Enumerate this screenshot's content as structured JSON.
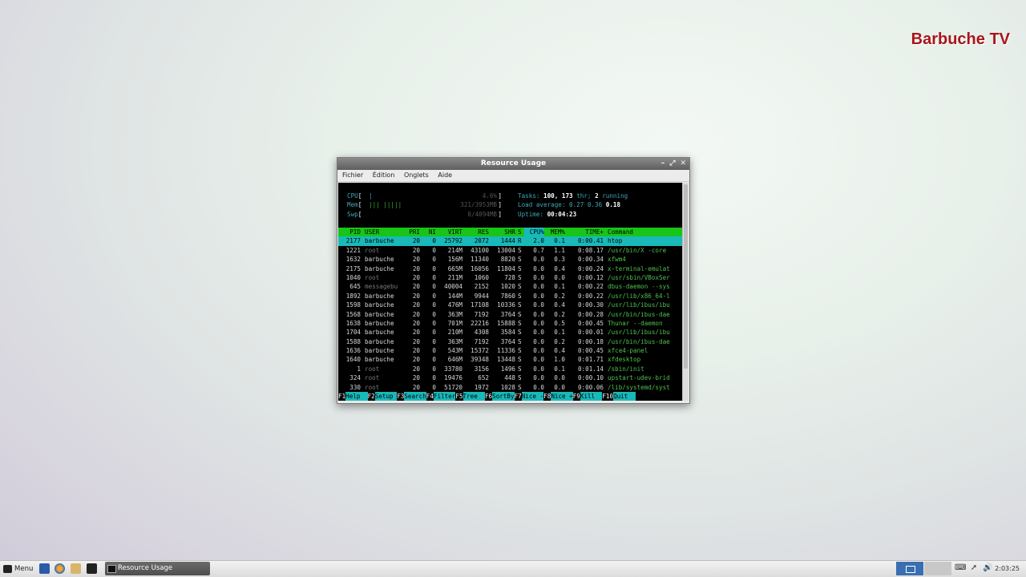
{
  "watermark": "Barbuche TV",
  "window": {
    "title": "Resource Usage",
    "menu": [
      "Fichier",
      "Édition",
      "Onglets",
      "Aide"
    ]
  },
  "meters": [
    {
      "label": "CPU",
      "bar": "|",
      "value": "4.6%"
    },
    {
      "label": "Mem",
      "bar": "||| |||||",
      "value": "321/3953MB"
    },
    {
      "label": "Swp",
      "bar": "",
      "value": "0/4094MB"
    }
  ],
  "stats": {
    "tasks_label": "Tasks:",
    "tasks": "100,",
    "threads": "173",
    "threads_label": "thr;",
    "running": "2",
    "running_label": "running",
    "load_label": "Load average:",
    "load1": "0.27",
    "load5": "0.36",
    "load15": "0.18",
    "uptime_label": "Uptime:",
    "uptime": "00:04:23"
  },
  "table": {
    "headers": [
      "PID",
      "USER",
      "PRI",
      "NI",
      "VIRT",
      "RES",
      "SHR",
      "S",
      "CPU%",
      "MEM%",
      "TIME+",
      "Command"
    ],
    "rows": [
      [
        "2177",
        "barbuche",
        "20",
        "0",
        "25792",
        "2072",
        "1444",
        "R",
        "2.0",
        "0.1",
        "0:00.41",
        "htop"
      ],
      [
        "1221",
        "root",
        "20",
        "0",
        "214M",
        "43100",
        "13004",
        "S",
        "0.7",
        "1.1",
        "0:08.17",
        "/usr/bin/X -core"
      ],
      [
        "1632",
        "barbuche",
        "20",
        "0",
        "156M",
        "11340",
        "8820",
        "S",
        "0.0",
        "0.3",
        "0:00.34",
        "xfwm4"
      ],
      [
        "2175",
        "barbuche",
        "20",
        "0",
        "665M",
        "16056",
        "11804",
        "S",
        "0.0",
        "0.4",
        "0:00.24",
        "x-terminal-emulat"
      ],
      [
        "1040",
        "root",
        "20",
        "0",
        "211M",
        "1060",
        "728",
        "S",
        "0.0",
        "0.0",
        "0:00.12",
        "/usr/sbin/VBoxSer"
      ],
      [
        "645",
        "messagebu",
        "20",
        "0",
        "40004",
        "2152",
        "1020",
        "S",
        "0.0",
        "0.1",
        "0:00.22",
        "dbus-daemon --sys"
      ],
      [
        "1892",
        "barbuche",
        "20",
        "0",
        "144M",
        "9944",
        "7860",
        "S",
        "0.0",
        "0.2",
        "0:00.22",
        "/usr/lib/x86_64-l"
      ],
      [
        "1598",
        "barbuche",
        "20",
        "0",
        "476M",
        "17108",
        "10336",
        "S",
        "0.0",
        "0.4",
        "0:00.30",
        "/usr/lib/ibus/ibu"
      ],
      [
        "1568",
        "barbuche",
        "20",
        "0",
        "363M",
        "7192",
        "3764",
        "S",
        "0.0",
        "0.2",
        "0:00.28",
        "/usr/bin/ibus-dae"
      ],
      [
        "1638",
        "barbuche",
        "20",
        "0",
        "701M",
        "22216",
        "15888",
        "S",
        "0.0",
        "0.5",
        "0:00.45",
        "Thunar --daemon"
      ],
      [
        "1704",
        "barbuche",
        "20",
        "0",
        "210M",
        "4308",
        "3584",
        "S",
        "0.0",
        "0.1",
        "0:00.01",
        "/usr/lib/ibus/ibu"
      ],
      [
        "1588",
        "barbuche",
        "20",
        "0",
        "363M",
        "7192",
        "3764",
        "S",
        "0.0",
        "0.2",
        "0:00.18",
        "/usr/bin/ibus-dae"
      ],
      [
        "1636",
        "barbuche",
        "20",
        "0",
        "543M",
        "15372",
        "11336",
        "S",
        "0.0",
        "0.4",
        "0:00.45",
        "xfce4-panel"
      ],
      [
        "1640",
        "barbuche",
        "20",
        "0",
        "646M",
        "39348",
        "13448",
        "S",
        "0.0",
        "1.0",
        "0:01.71",
        "xfdesktop"
      ],
      [
        "1",
        "root",
        "20",
        "0",
        "33780",
        "3156",
        "1496",
        "S",
        "0.0",
        "0.1",
        "0:01.14",
        "/sbin/init"
      ],
      [
        "324",
        "root",
        "20",
        "0",
        "19476",
        "652",
        "448",
        "S",
        "0.0",
        "0.0",
        "0:00.10",
        "upstart-udev-brid"
      ],
      [
        "330",
        "root",
        "20",
        "0",
        "51720",
        "1972",
        "1028",
        "S",
        "0.0",
        "0.0",
        "0:00.06",
        "/lib/systemd/syst"
      ]
    ]
  },
  "fkeys": [
    {
      "key": "F1",
      "label": "Help  "
    },
    {
      "key": "F2",
      "label": "Setup "
    },
    {
      "key": "F3",
      "label": "Search"
    },
    {
      "key": "F4",
      "label": "Filter"
    },
    {
      "key": "F5",
      "label": "Tree  "
    },
    {
      "key": "F6",
      "label": "SortBy"
    },
    {
      "key": "F7",
      "label": "Nice -"
    },
    {
      "key": "F8",
      "label": "Nice +"
    },
    {
      "key": "F9",
      "label": "Kill  "
    },
    {
      "key": "F10",
      "label": "Quit  "
    }
  ],
  "taskbar": {
    "menu_label": "Menu",
    "task_label": "Resource Usage",
    "clock": "2:03:25"
  },
  "colors": {
    "header_green": "#18c418",
    "selection_cyan": "#19b9ba",
    "watermark_red": "#a8161b"
  }
}
